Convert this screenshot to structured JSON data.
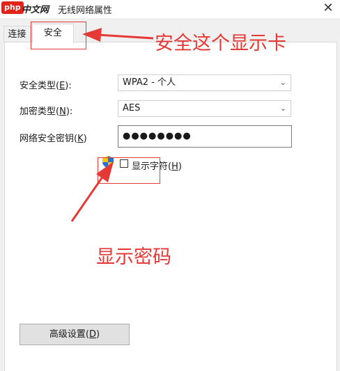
{
  "window": {
    "logo_php": "php",
    "logo_cn": "中文网",
    "title": "无线网络属性",
    "close_glyph": "✕"
  },
  "tabs": [
    {
      "label": "连接",
      "active": false
    },
    {
      "label": "安全",
      "active": true
    }
  ],
  "form": {
    "security_type_label_pre": "安全类型(",
    "security_type_key": "E",
    "security_type_label_post": "):",
    "security_type_value": "WPA2 - 个人",
    "encryption_type_label_pre": "加密类型(",
    "encryption_type_key": "N",
    "encryption_type_label_post": "):",
    "encryption_type_value": "AES",
    "key_label_pre": "网络安全密钥(",
    "key_key": "K",
    "key_label_post": ")",
    "key_value": "●●●●●●●●",
    "show_chars_label_pre": "显示字符(",
    "show_chars_key": "H",
    "show_chars_label_post": ")",
    "show_chars_checked": false
  },
  "advanced_button": {
    "label_pre": "高级设置(",
    "key": "D",
    "label_post": ")"
  },
  "annotations": {
    "tab_note": "安全这个显示卡",
    "password_note": "显示密码",
    "color": "#e53935"
  },
  "icons": {
    "shield": "uac-shield-icon",
    "chevron": "chevron-down-icon",
    "close": "close-icon"
  }
}
